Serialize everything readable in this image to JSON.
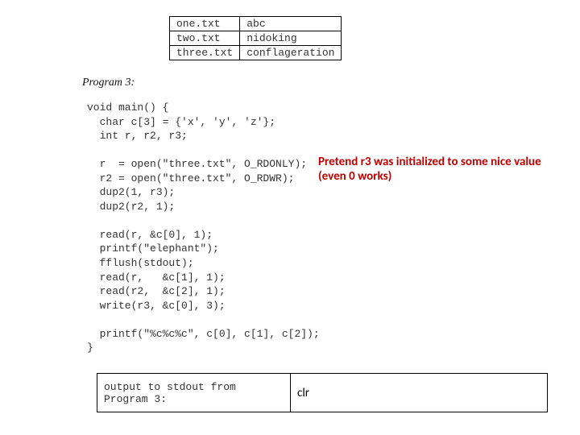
{
  "files": {
    "rows": [
      {
        "name": "one.txt",
        "content": "abc"
      },
      {
        "name": "two.txt",
        "content": "nidoking"
      },
      {
        "name": "three.txt",
        "content": "conflageration"
      }
    ]
  },
  "program": {
    "label": "Program 3:",
    "code": "void main() {\n  char c[3] = {'x', 'y', 'z'};\n  int r, r2, r3;\n\n  r  = open(\"three.txt\", O_RDONLY);\n  r2 = open(\"three.txt\", O_RDWR);\n  dup2(1, r3);\n  dup2(r2, 1);\n\n  read(r, &c[0], 1);\n  printf(\"elephant\");\n  fflush(stdout);\n  read(r,   &c[1], 1);\n  read(r2,  &c[2], 1);\n  write(r3, &c[0], 3);\n\n  printf(\"%c%c%c\", c[0], c[1], c[2]);\n}"
  },
  "annotation": {
    "text": "Pretend r3 was initialized to some nice value (even 0 works)"
  },
  "output": {
    "label": "output to stdout from Program 3:",
    "answer": "clr"
  }
}
